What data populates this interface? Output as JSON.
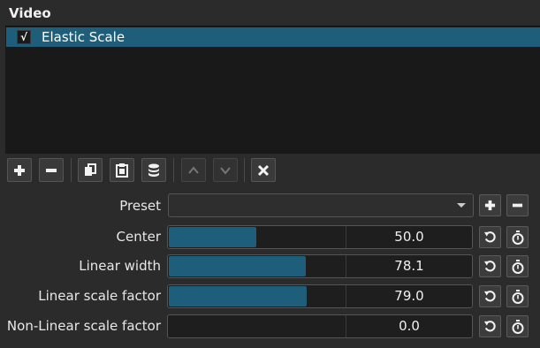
{
  "panel": {
    "title": "Video"
  },
  "filters": [
    {
      "name": "Elastic Scale",
      "checked": "√"
    }
  ],
  "toolbar": {
    "add": "add-filter",
    "remove": "remove-filter",
    "copy": "copy-filter",
    "paste": "paste-filter",
    "save": "save-filter-set",
    "up": "move-up",
    "down": "move-down",
    "close": "close"
  },
  "preset": {
    "label": "Preset",
    "value": ""
  },
  "params": [
    {
      "label": "Center",
      "value": "50.0",
      "fraction": 0.5
    },
    {
      "label": "Linear width",
      "value": "78.1",
      "fraction": 0.781
    },
    {
      "label": "Linear scale factor",
      "value": "79.0",
      "fraction": 0.79
    },
    {
      "label": "Non-Linear scale factor",
      "value": "0.0",
      "fraction": 0.0
    }
  ],
  "colors": {
    "accent": "#1e5e7b",
    "background": "#2b2b2b",
    "list_background": "#191919"
  }
}
